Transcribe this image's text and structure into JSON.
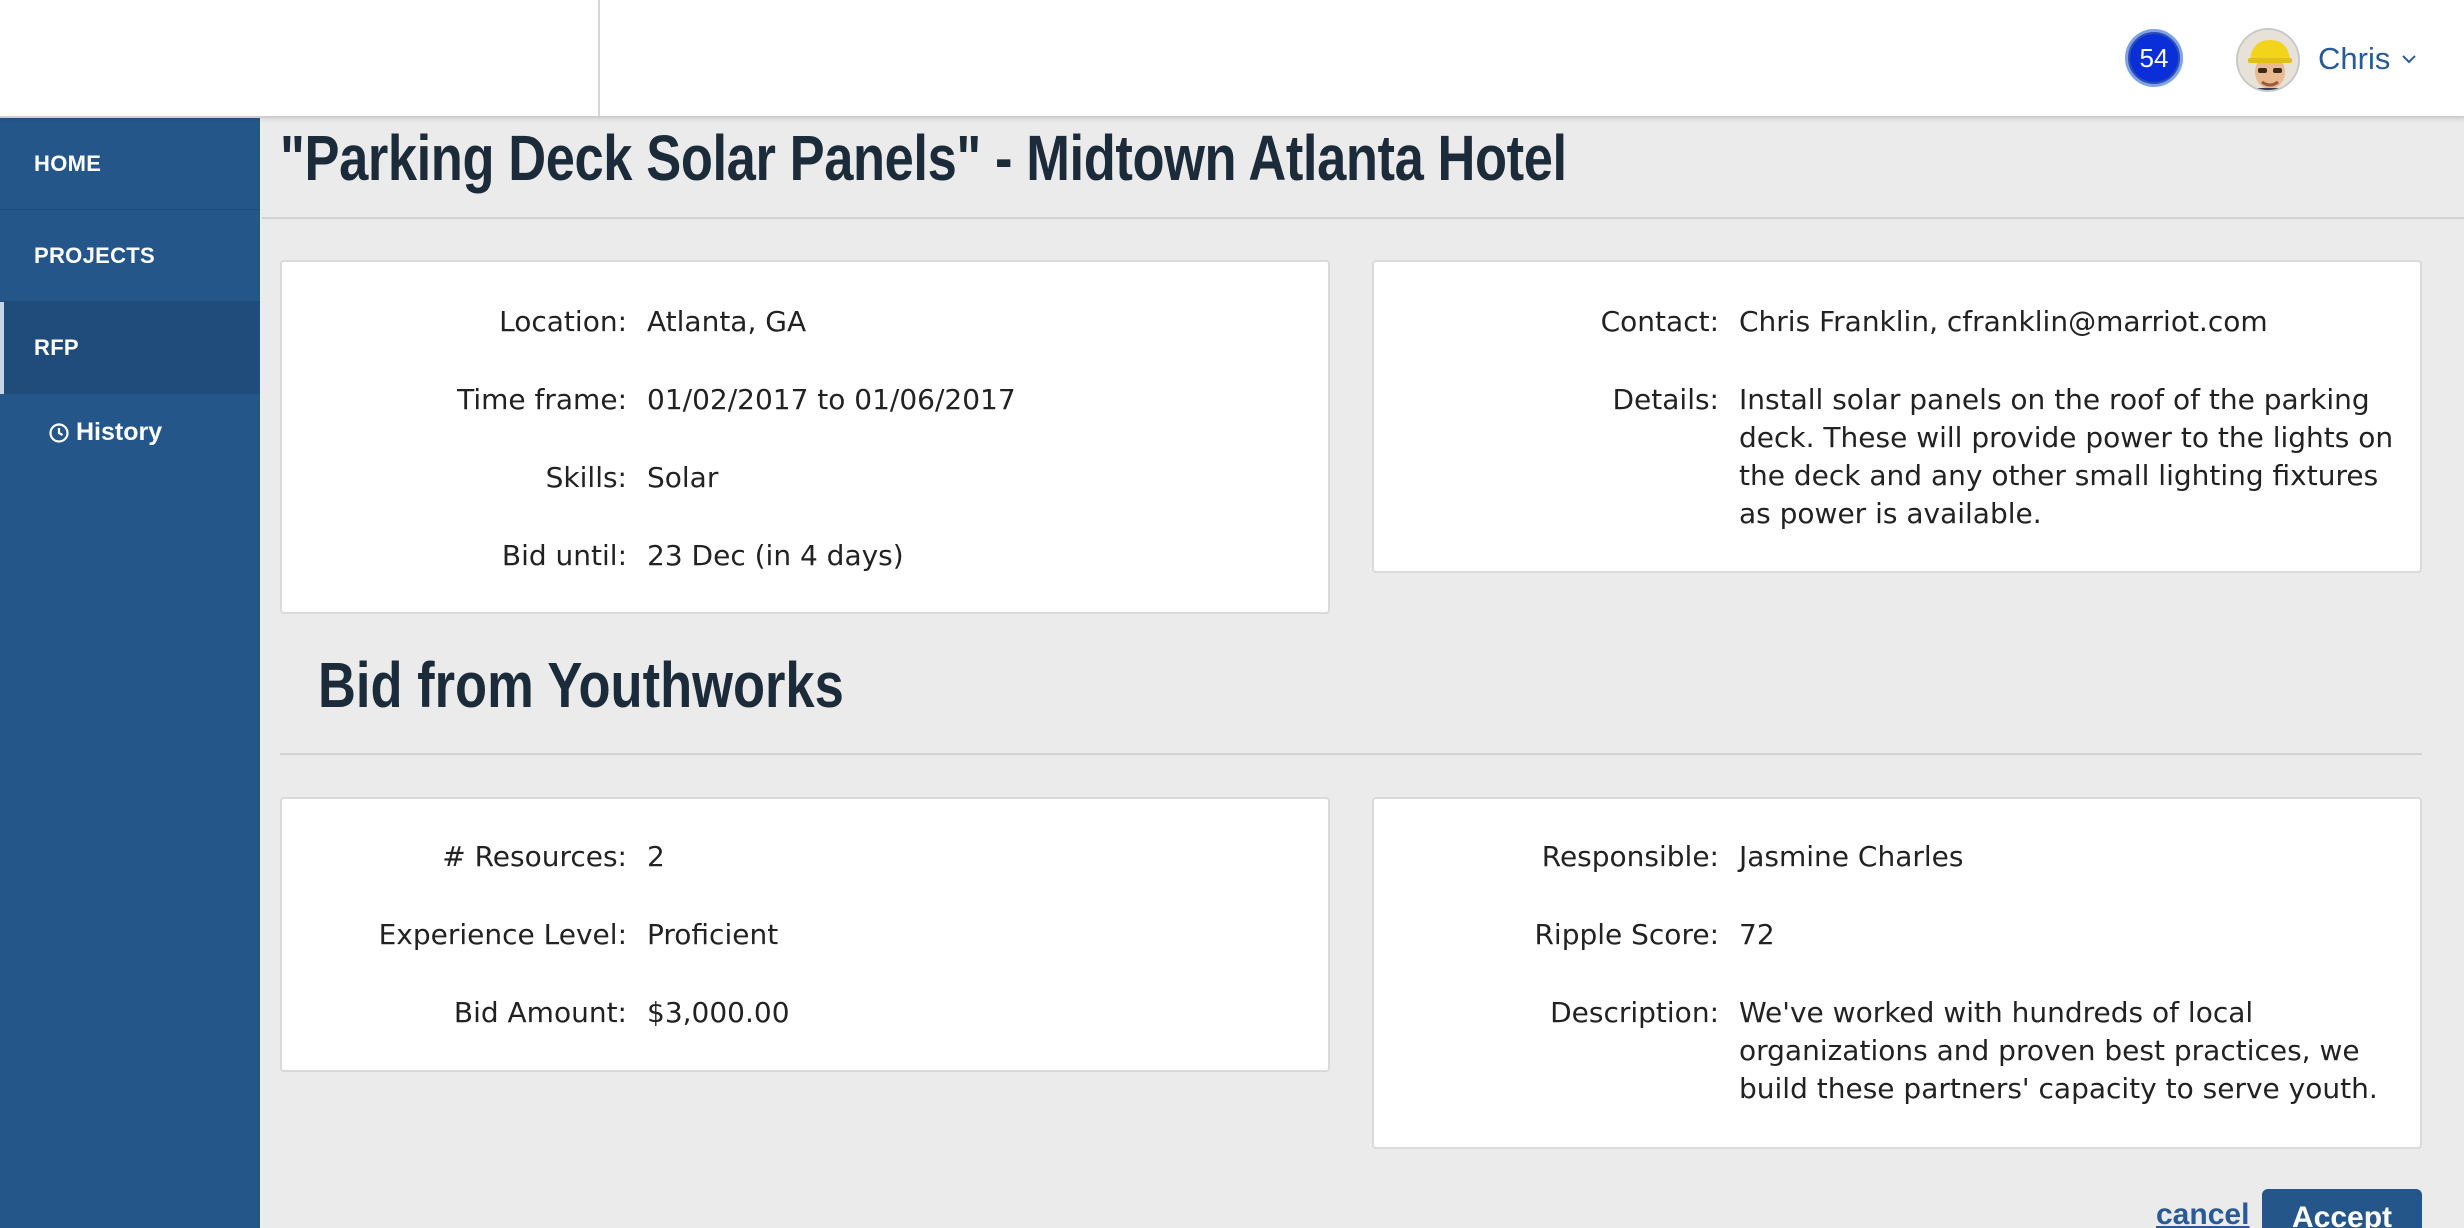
{
  "header": {
    "notification_count": "54",
    "user_name": "Chris"
  },
  "sidebar": {
    "items": [
      {
        "label": "HOME"
      },
      {
        "label": "PROJECTS"
      },
      {
        "label": "RFP"
      }
    ],
    "sub_item": "History"
  },
  "page": {
    "title": "\"Parking Deck Solar Panels\" - Midtown Atlanta Hotel"
  },
  "rfp": {
    "location_label": "Location:",
    "location": "Atlanta, GA",
    "timeframe_label": "Time frame:",
    "timeframe": "01/02/2017 to 01/06/2017",
    "skills_label": "Skills:",
    "skills": "Solar",
    "bid_until_label": "Bid until:",
    "bid_until": "23 Dec (in 4 days)",
    "contact_label": "Contact:",
    "contact": "Chris Franklin, cfranklin@marriot.com",
    "details_label": "Details:",
    "details": "Install solar panels on the roof of the parking deck. These will provide power to the lights on the deck and any other small lighting fixtures as power is available."
  },
  "bid": {
    "title": "Bid from Youthworks",
    "resources_label": "# Resources:",
    "resources": "2",
    "experience_label": "Experience Level:",
    "experience": "Proficient",
    "amount_label": "Bid Amount:",
    "amount": "$3,000.00",
    "responsible_label": "Responsible:",
    "responsible": "Jasmine Charles",
    "score_label": "Ripple Score:",
    "score": "72",
    "description_label": "Description:",
    "description": "We've worked with hundreds of local organizations and proven best practices, we build these partners' capacity to serve youth."
  },
  "actions": {
    "cancel": "cancel",
    "accept": "Accept"
  }
}
